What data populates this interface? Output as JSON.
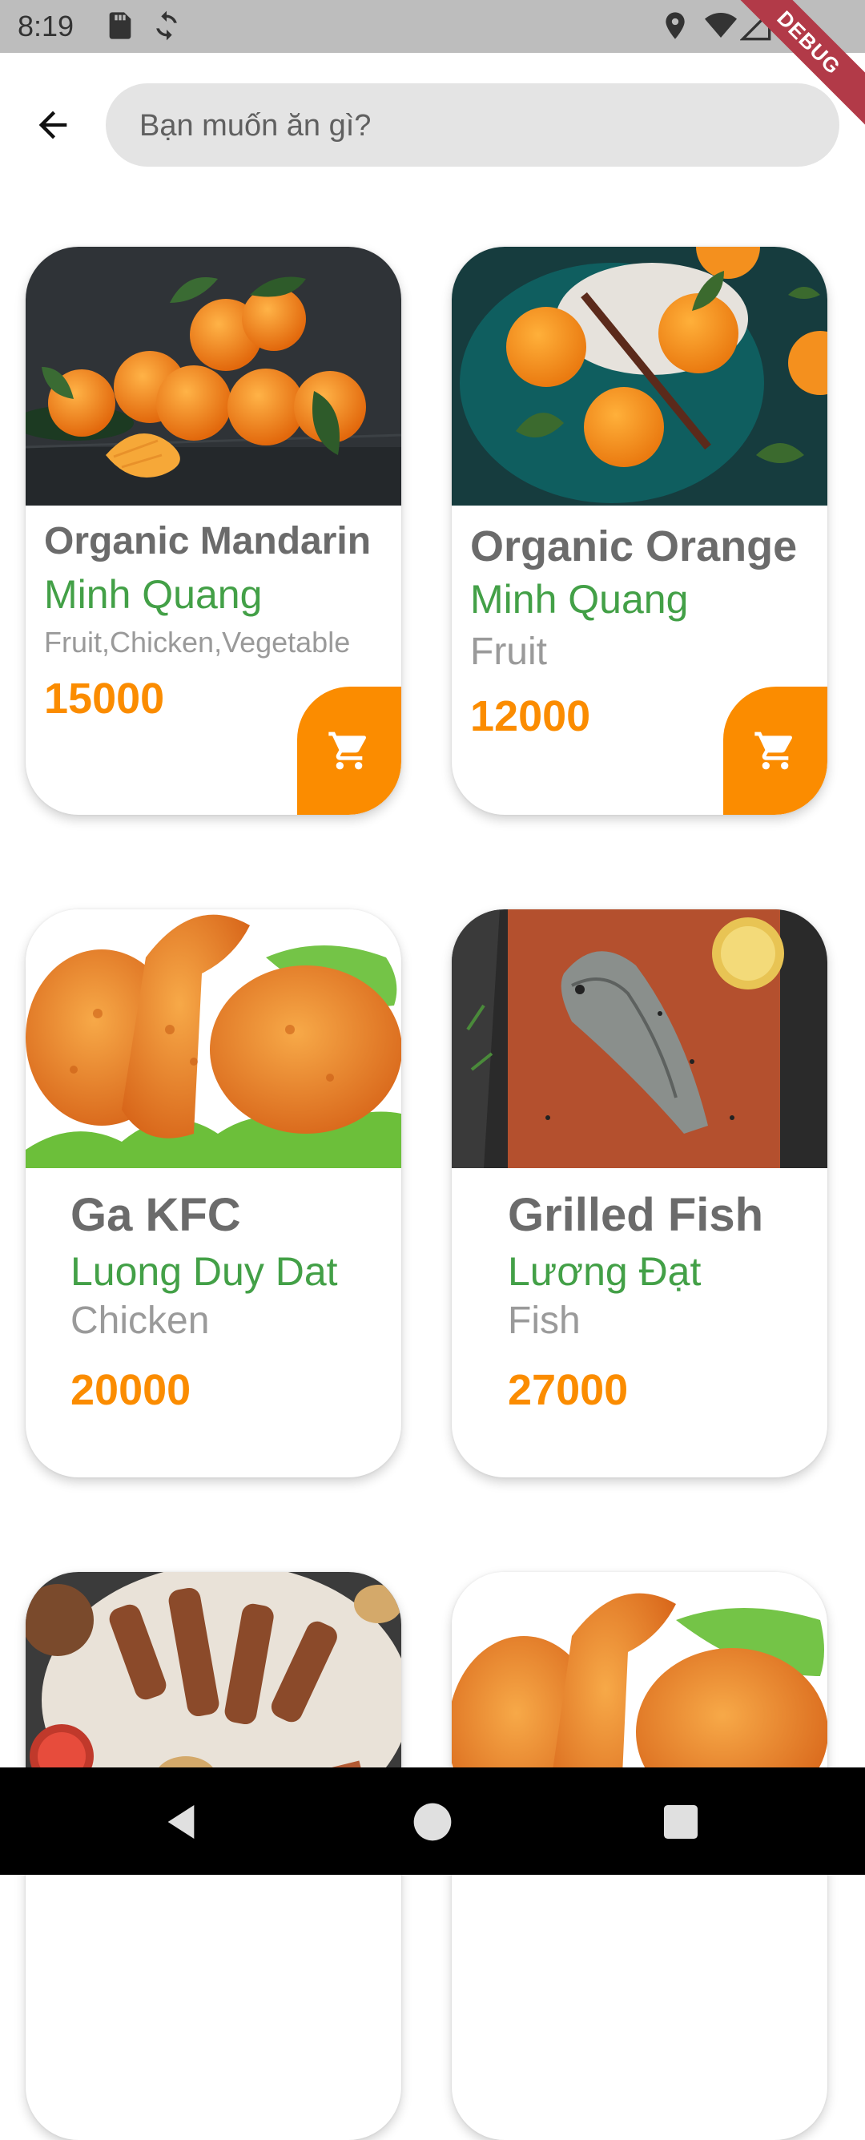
{
  "status_bar": {
    "time": "8:19",
    "debug_label": "DEBUG"
  },
  "search": {
    "placeholder": "Bạn muốn ăn gì?"
  },
  "products": [
    {
      "title": "Organic Mandarin",
      "shop": "Minh Quang",
      "categories": "Fruit,Chicken,Vegetable",
      "price": "15000",
      "has_cart": true
    },
    {
      "title": "Organic Orange",
      "shop": "Minh Quang",
      "categories": "Fruit",
      "price": "12000",
      "has_cart": true
    },
    {
      "title": "Ga KFC",
      "shop": "Luong Duy Dat",
      "categories": "Chicken",
      "price": "20000",
      "has_cart": false
    },
    {
      "title": "Grilled Fish",
      "shop": "Lương Đạt",
      "categories": "Fish",
      "price": "27000",
      "has_cart": false
    }
  ],
  "colors": {
    "accent": "#fb8c00",
    "shop_green": "#43a047",
    "title_gray": "#6b6b6b"
  },
  "icons": [
    "arrow-back-icon",
    "cart-icon",
    "location-icon",
    "wifi-icon",
    "signal-icon",
    "battery-icon",
    "sd-card-icon",
    "sync-icon"
  ]
}
